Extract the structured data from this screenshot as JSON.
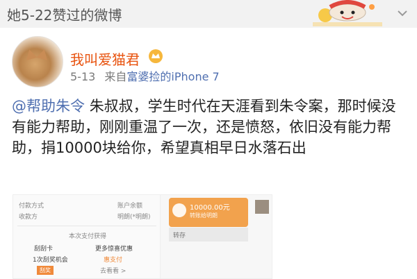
{
  "header": {
    "title": "她5-22赞过的微博"
  },
  "post": {
    "username": "我叫爱猫君",
    "time": "5-13",
    "from_label": "来自",
    "source": "富婆捡的iPhone 7",
    "mention": "@帮助朱令",
    "content": "朱叔叔，学生时代在天涯看到朱令案，那时候没有能力帮助，刚刚重温了一次，还是愤怒，依旧没有能力帮助，捐10000块给你，希望真相早日水落石出"
  },
  "embedded_screenshot": {
    "left": {
      "pay_method_label": "付款方式",
      "pay_method_value": "账户余额",
      "payee_label": "收款方",
      "payee_value": "明朗(*明朗)",
      "section_title": "本次支付获得",
      "card1_title": "刮刮卡",
      "card1_sub": "1次刮奖机会",
      "card1_btn": "刮奖",
      "card2_title": "更多惊喜优惠",
      "card2_sub": "惠支付",
      "card2_link": "去看看 >"
    },
    "right": {
      "amount": "10000.00元",
      "subtitle": "转账给明朗",
      "note": "转存"
    }
  },
  "colors": {
    "username": "#e8530f",
    "link": "#4f6fb0",
    "accent_orange": "#f2a24d"
  }
}
